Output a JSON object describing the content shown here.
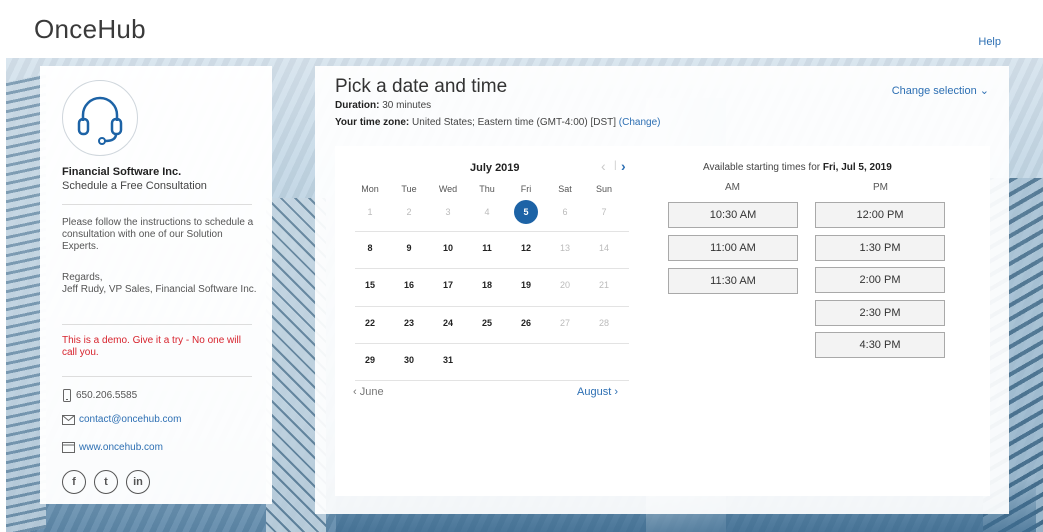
{
  "header": {
    "logo": "OnceHub",
    "help": "Help"
  },
  "profile": {
    "company": "Financial Software Inc.",
    "subtitle": "Schedule a Free Consultation",
    "instructions": "Please follow the instructions to schedule a consultation with one of our Solution Experts.",
    "regards": "Regards,\nJeff Rudy, VP Sales, Financial Software Inc.",
    "demo_note": "This is a demo. Give it a try - No one will call you.",
    "phone": "650.206.5585",
    "email": "contact@oncehub.com",
    "website": "www.oncehub.com",
    "social": [
      "f",
      "t",
      "in"
    ]
  },
  "main": {
    "title": "Pick a date and time",
    "duration_label": "Duration:",
    "duration_value": "30 minutes",
    "timezone_label": "Your time zone:",
    "timezone_value": "United States;  Eastern time  (GMT-4:00) [DST]",
    "change_tz": "(Change)",
    "change_selection": "Change selection"
  },
  "calendar": {
    "month": "July 2019",
    "weekdays": [
      "Mon",
      "Tue",
      "Wed",
      "Thu",
      "Fri",
      "Sat",
      "Sun"
    ],
    "weeks": [
      [
        "1",
        "2",
        "3",
        "4",
        "5",
        "6",
        "7"
      ],
      [
        "8",
        "9",
        "10",
        "11",
        "12",
        "13",
        "14"
      ],
      [
        "15",
        "16",
        "17",
        "18",
        "19",
        "20",
        "21"
      ],
      [
        "22",
        "23",
        "24",
        "25",
        "26",
        "27",
        "28"
      ],
      [
        "29",
        "30",
        "31",
        "",
        "",
        "",
        ""
      ]
    ],
    "selected_day": "5",
    "prev_month": "June",
    "next_month": "August"
  },
  "times": {
    "heading_prefix": "Available starting times for ",
    "heading_date": "Fri, Jul 5, 2019",
    "am_label": "AM",
    "pm_label": "PM",
    "am": [
      "10:30 AM",
      "11:00 AM",
      "11:30 AM"
    ],
    "pm": [
      "12:00 PM",
      "1:30 PM",
      "2:00 PM",
      "2:30 PM",
      "4:30 PM"
    ]
  },
  "colors": {
    "accent": "#2d6fb3",
    "selected": "#1d63a6",
    "demo": "#d7232d"
  }
}
